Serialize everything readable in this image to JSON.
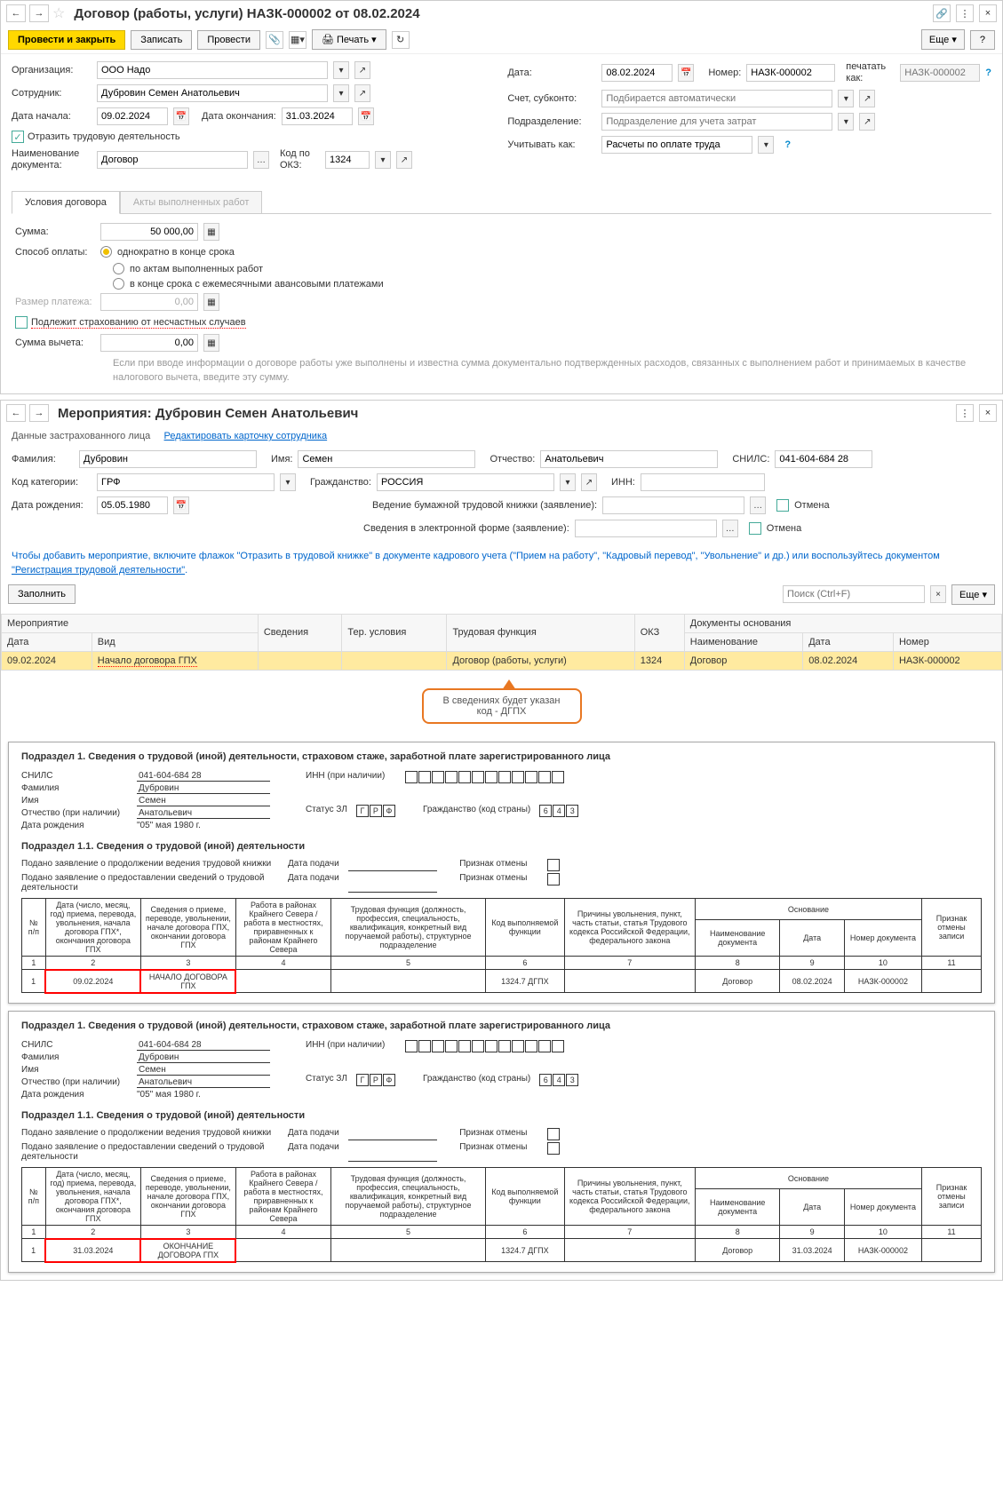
{
  "win1": {
    "title": "Договор (работы, услуги) НАЗК-000002 от 08.02.2024",
    "toolbar": {
      "post_close": "Провести и закрыть",
      "save": "Записать",
      "post": "Провести",
      "print": "Печать",
      "more": "Еще"
    },
    "org_label": "Организация:",
    "org": "ООО Надо",
    "emp_label": "Сотрудник:",
    "emp": "Дубровин Семен Анатольевич",
    "start_label": "Дата начала:",
    "start": "09.02.2024",
    "end_label": "Дата окончания:",
    "end": "31.03.2024",
    "reflect": "Отразить трудовую деятельность",
    "docname_label": "Наименование документа:",
    "docname": "Договор",
    "okz_label": "Код по ОКЗ:",
    "okz": "1324",
    "date_label": "Дата:",
    "date": "08.02.2024",
    "num_label": "Номер:",
    "num": "НАЗК-000002",
    "printas_label": "печатать как:",
    "printas_ph": "НАЗК-000002",
    "account_label": "Счет, субконто:",
    "account_ph": "Подбирается автоматически",
    "dept_label": "Подразделение:",
    "dept_ph": "Подразделение для учета затрат",
    "consider_label": "Учитывать как:",
    "consider": "Расчеты по оплате труда",
    "tab1": "Условия договора",
    "tab2": "Акты выполненных работ",
    "sum_label": "Сумма:",
    "sum": "50 000,00",
    "pay_label": "Способ оплаты:",
    "pay1": "однократно в конце срока",
    "pay2": "по актам выполненных работ",
    "pay3": "в конце срока с ежемесячными авансовыми платежами",
    "installment_label": "Размер платежа:",
    "installment": "0,00",
    "insurance": "Подлежит страхованию от несчастных случаев",
    "deduct_label": "Сумма вычета:",
    "deduct": "0,00",
    "hint": "Если при вводе информации о договоре работы уже выполнены и известна сумма документально подтвержденных расходов, связанных с выполнением работ и принимаемых в качестве налогового вычета, введите эту сумму."
  },
  "win2": {
    "title": "Мероприятия: Дубровин Семен Анатольевич",
    "insured_heading": "Данные застрахованного лица",
    "edit_link": "Редактировать карточку сотрудника",
    "surname_label": "Фамилия:",
    "surname": "Дубровин",
    "name_label": "Имя:",
    "name": "Семен",
    "patr_label": "Отчество:",
    "patr": "Анатольевич",
    "snils_label": "СНИЛС:",
    "snils": "041-604-684 28",
    "cat_label": "Код категории:",
    "cat": "ГРФ",
    "citizen_label": "Гражданство:",
    "citizen": "РОССИЯ",
    "inn_label": "ИНН:",
    "birth_label": "Дата рождения:",
    "birth": "05.05.1980",
    "paper_label": "Ведение бумажной трудовой книжки (заявление):",
    "elec_label": "Сведения в электронной форме (заявление):",
    "cancel": "Отмена",
    "hint1": "Чтобы добавить мероприятие, включите флажок \"Отразить в трудовой книжке\" в документе кадрового учета (\"Прием на работу\", \"Кадровый перевод\", \"Увольнение\" и др.) или воспользуйтесь документом ",
    "hint1_link": "\"Регистрация трудовой деятельности\"",
    "fill": "Заполнить",
    "search_ph": "Поиск (Ctrl+F)",
    "more": "Еще",
    "headers": {
      "event": "Мероприятие",
      "info": "Сведения",
      "terr": "Тер. условия",
      "func": "Трудовая функция",
      "okz": "ОКЗ",
      "basis": "Документы основания",
      "date": "Дата",
      "type": "Вид",
      "name": "Наименование",
      "bdate": "Дата",
      "num": "Номер"
    },
    "row": {
      "date": "09.02.2024",
      "type": "Начало договора ГПХ",
      "func": "Договор (работы, услуги)",
      "okz": "1324",
      "bname": "Договор",
      "bdate": "08.02.2024",
      "bnum": "НАЗК-000002"
    },
    "callout": "В сведениях будет указан код - ДГПХ"
  },
  "report": {
    "h1": "Подраздел 1. Сведения о трудовой (иной) деятельности, страховом стаже, заработной плате зарегистрированного лица",
    "h11": "Подраздел 1.1. Сведения о трудовой (иной) деятельности",
    "snils_l": "СНИЛС",
    "snils": "041-604-684 28",
    "surname_l": "Фамилия",
    "surname": "Дубровин",
    "name_l": "Имя",
    "name": "Семен",
    "patr_l": "Отчество (при наличии)",
    "patr": "Анатольевич",
    "birth_l": "Дата рождения",
    "birth": "\"05\" мая 1980 г.",
    "inn_l": "ИНН (при наличии)",
    "status_l": "Статус ЗЛ",
    "status": [
      "Г",
      "Р",
      "Ф"
    ],
    "citizen_l": "Гражданство (код страны)",
    "citizen": [
      "6",
      "4",
      "3"
    ],
    "stmt1": "Подано заявление о продолжении ведения трудовой книжки",
    "stmt2": "Подано заявление о предоставлении сведений о трудовой деятельности",
    "date_l": "Дата подачи",
    "cancel_l": "Признак отмены",
    "cols": {
      "c1": "№ п/п",
      "c2": "Дата (число, месяц, год) приема, перевода, увольнения, начала договора ГПХ*, окончания договора ГПХ",
      "c3": "Сведения о приеме, переводе, увольнении, начале договора ГПХ, окончании договора ГПХ",
      "c4": "Работа в районах Крайнего Севера / работа в местностях, приравненных к районам Крайнего Севера",
      "c5": "Трудовая функция (должность, профессия, специальность, квалификация, конкретный вид поручаемой работы), структурное подразделение",
      "c6": "Код выполняемой функции",
      "c7": "Причины увольнения, пункт, часть статьи, статья Трудового кодекса Российской Федерации, федерального закона",
      "c8": "Основание",
      "c8a": "Наименование документа",
      "c8b": "Дата",
      "c8c": "Номер документа",
      "c9": "Признак отмены записи"
    },
    "nums": [
      "1",
      "2",
      "3",
      "4",
      "5",
      "6",
      "7",
      "8",
      "9",
      "10",
      "11"
    ],
    "r1": {
      "n": "1",
      "date": "09.02.2024",
      "event": "НАЧАЛО ДОГОВОРА ГПХ",
      "code": "1324.7 ДГПХ",
      "bname": "Договор",
      "bdate": "08.02.2024",
      "bnum": "НАЗК-000002"
    },
    "r2": {
      "n": "1",
      "date": "31.03.2024",
      "event": "ОКОНЧАНИЕ ДОГОВОРА ГПХ",
      "code": "1324.7 ДГПХ",
      "bname": "Договор",
      "bdate": "31.03.2024",
      "bnum": "НАЗК-000002"
    }
  }
}
